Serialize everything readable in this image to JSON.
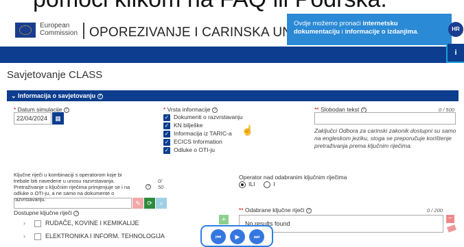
{
  "caption": "pomoći klikom na FAQ ili Podrška.",
  "header": {
    "org_line1": "European",
    "org_line2": "Commission",
    "site_title": "OPOREZIVANJE I CARINSKA UNIJA",
    "tip_prefix": "Ovdje možemo pronaći ",
    "tip_bold1": "internetsku dokumentaciju",
    "tip_mid": " i ",
    "tip_bold2": "informacije o izdanjima",
    "tip_suffix": ".",
    "lang_badge": "HR",
    "info_icon": "i"
  },
  "page": {
    "heading": "Savjetovanje CLASS",
    "panel_title": "Informacija o savjetovanju"
  },
  "form": {
    "date_label": "Datum simulacije",
    "date_value": "22/04/2024",
    "info_type_label": "Vrsta informacije",
    "info_types": [
      "Dokumenti o razvrstavanju",
      "KN bilješke",
      "Informacija iz TARIC-a",
      "ECICS Information",
      "Odluke o OTI-ju"
    ],
    "free_text_label": "Slobodan tekst",
    "free_text_counter": "0 / 500",
    "free_text_note": "Zaključci Odbora za carinski zakonik dostupni su samo na engleskom jeziku, stoga se preporučuje korištenje pretraživanja prema ključnim riječima.",
    "keywords_desc": "Ključne riječi u kombinaciji s operatorom koje bi trebale biti navedene u unosu razvrstavanja. Pretraživanje s ključnim riječima primjenjuje se i na odluke o OTI-ju, a ne samo na dokumente o razvrstavanju.",
    "keywords_counter_top": "0/",
    "keywords_counter_bottom": "50",
    "operator_label": "Operator nad odabranim ključnim riječima",
    "operator_or": "ILI",
    "operator_and": "I",
    "available_label": "Dostupne ključne riječi",
    "tree_items": [
      "RUDAČE, KOVINE I KEMIKALIJE",
      "ELEKTRONIKA I INFORM. TEHNOLOGIJA"
    ],
    "selected_label": "Odabrane ključne riječi",
    "selected_counter": "0 / 200",
    "selected_empty": "No results found"
  },
  "colors": {
    "brand_blue": "#0d3d8e",
    "tip_blue": "#2b8ad6",
    "required_red": "#cc0000"
  }
}
